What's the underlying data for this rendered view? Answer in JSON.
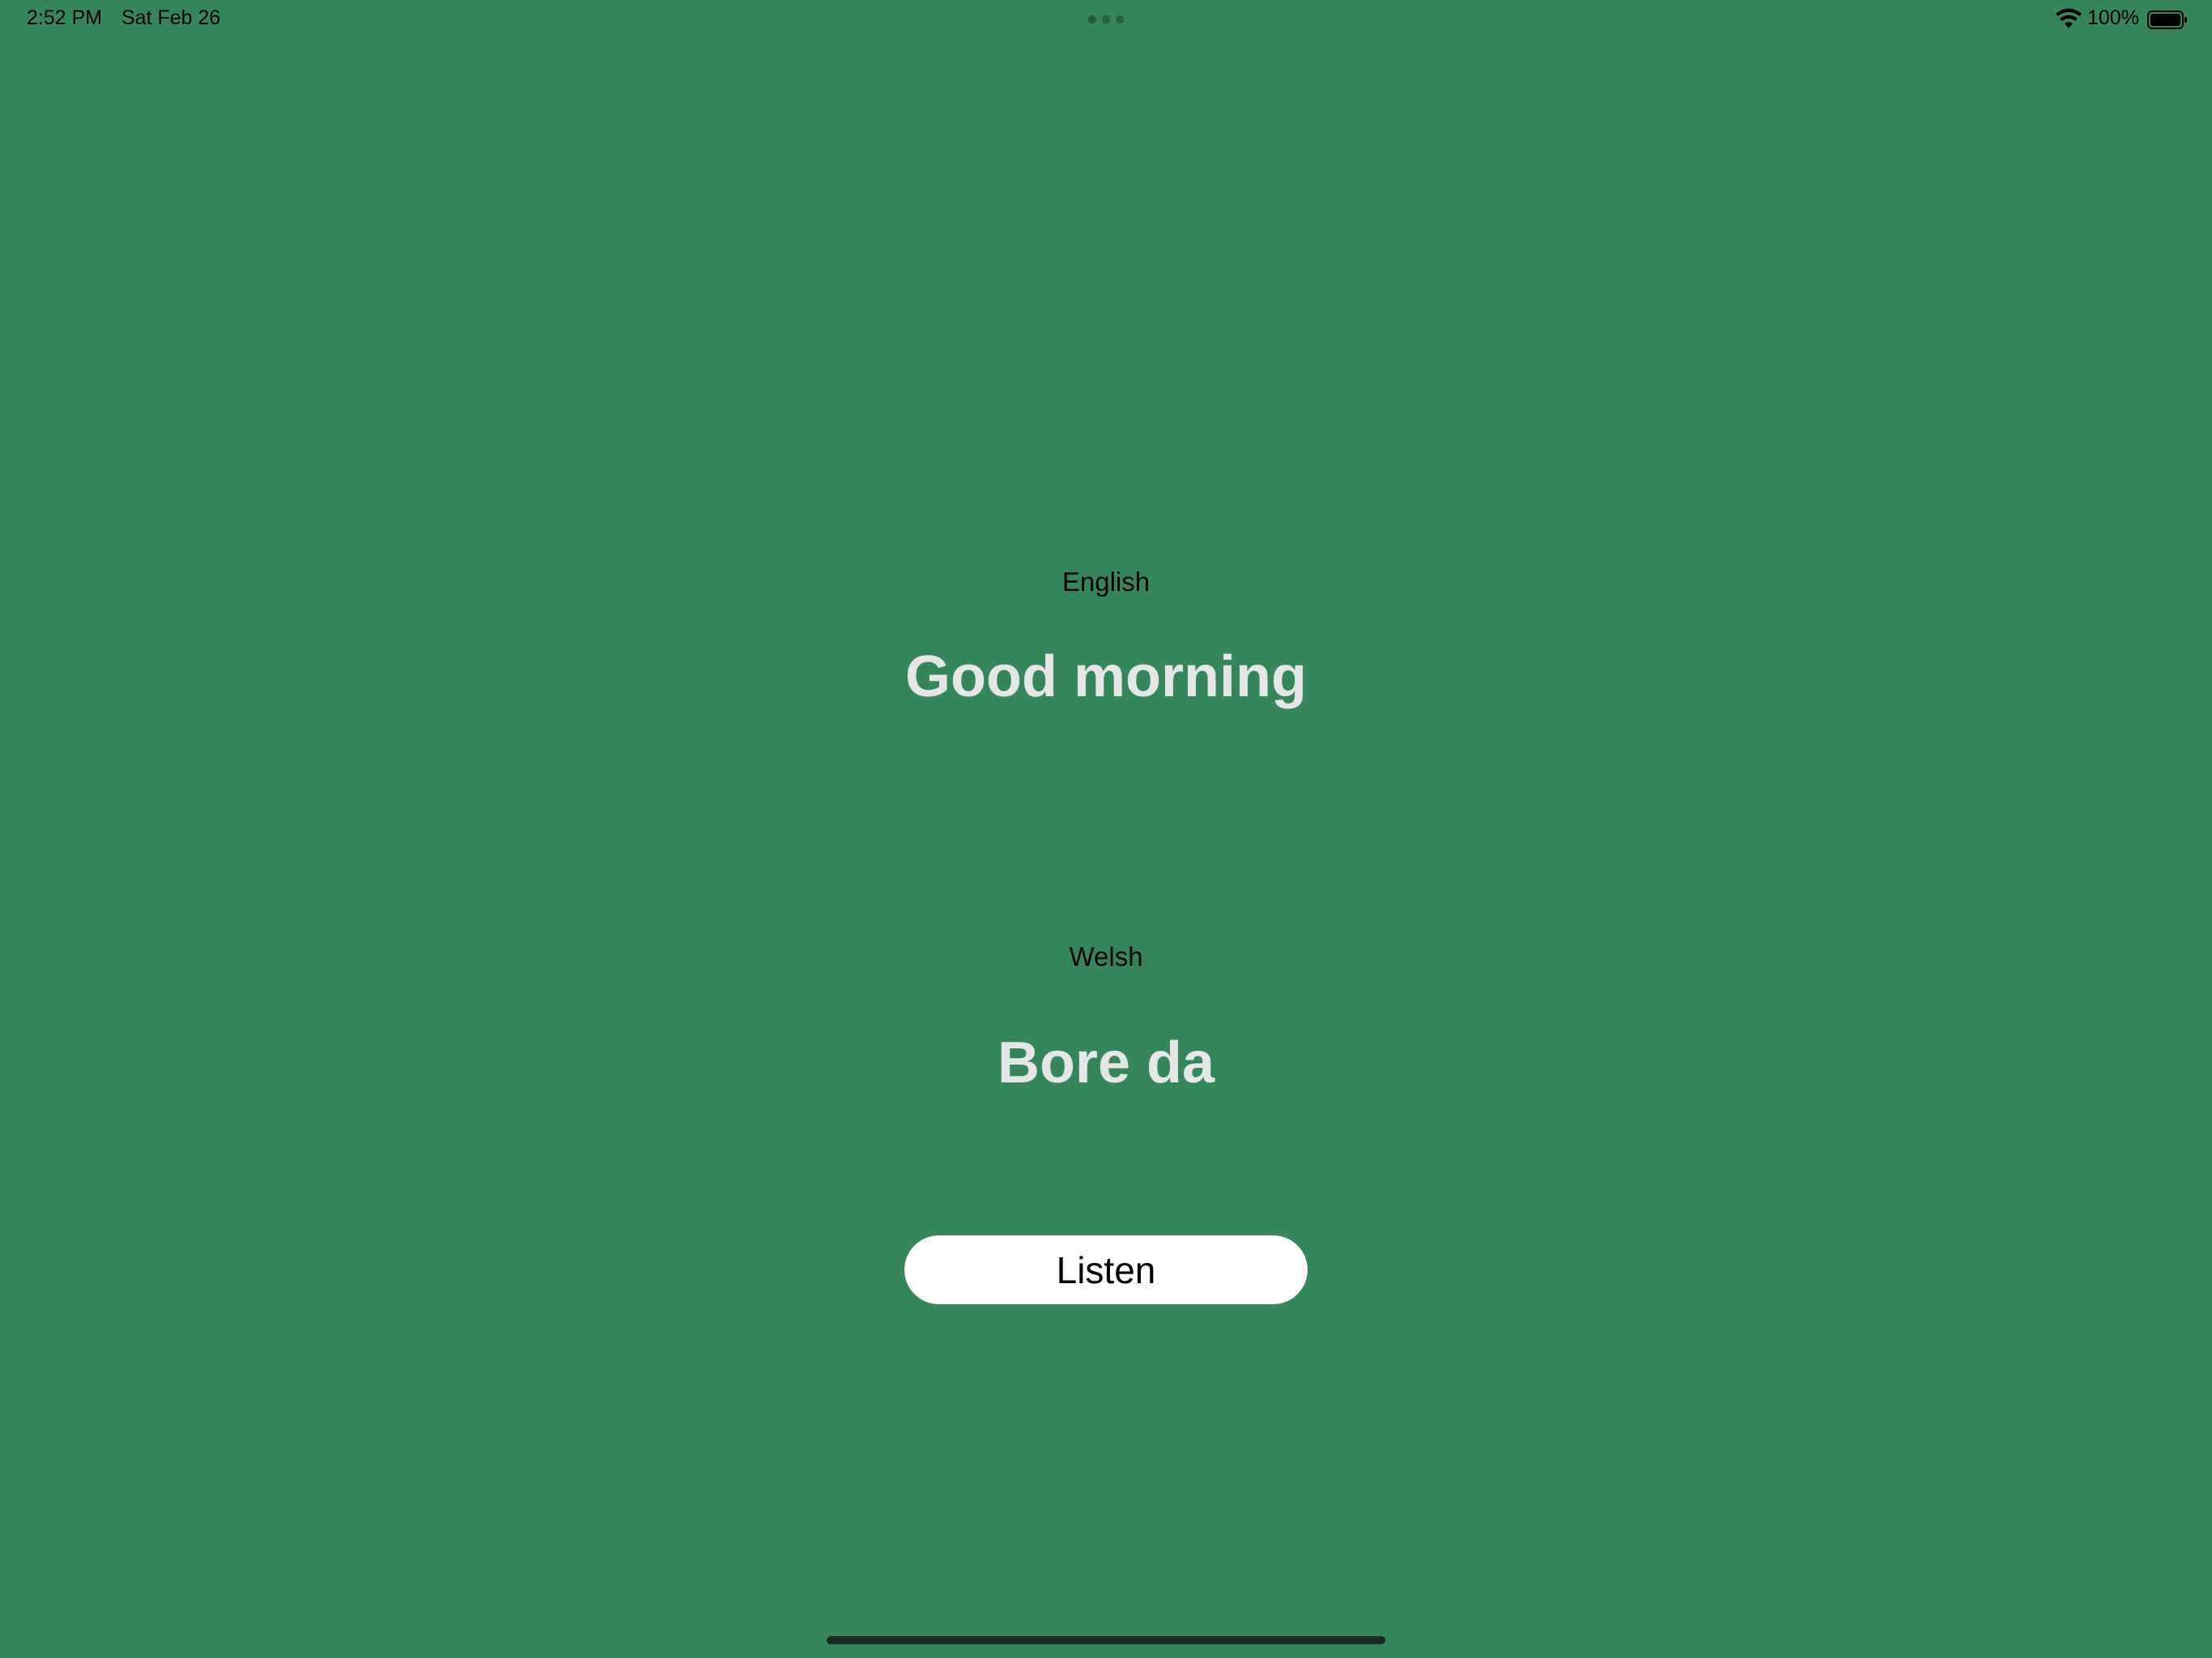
{
  "status_bar": {
    "time": "2:52 PM",
    "date": "Sat Feb 26",
    "battery_percent": "100%",
    "battery_level": 1.0,
    "icons": [
      "multitask-dots-icon",
      "wifi-icon",
      "battery-icon"
    ]
  },
  "colors": {
    "background": "#36865b",
    "phrase_text": "#e6e6e6",
    "button_background": "#ffffff"
  },
  "english": {
    "label": "English",
    "phrase": "Good morning"
  },
  "welsh": {
    "label": "Welsh",
    "phrase": "Bore da"
  },
  "actions": {
    "listen_label": "Listen"
  }
}
